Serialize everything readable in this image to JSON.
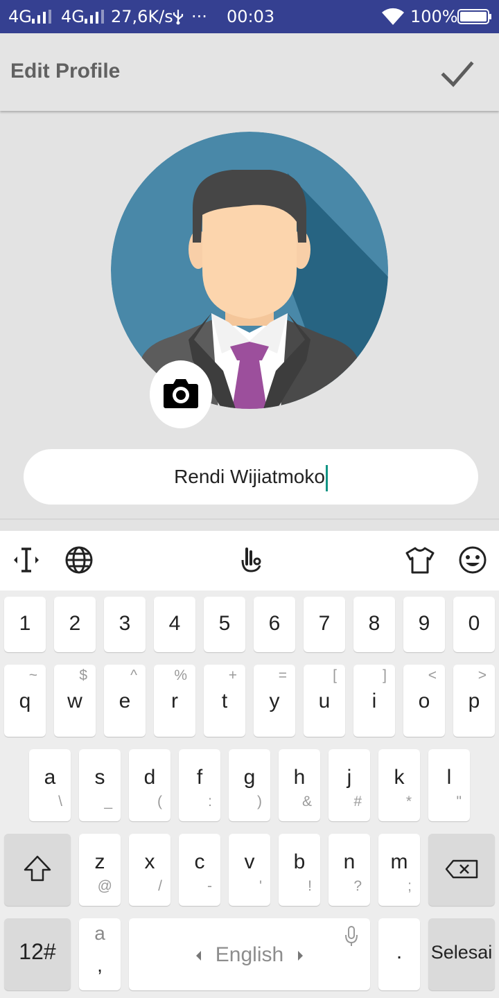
{
  "status_bar": {
    "network1": "4G",
    "network2": "4G",
    "speed": "27,6K/s",
    "usb_icon": "usb-icon",
    "more": "···",
    "time": "00:03",
    "battery": "100%"
  },
  "app_bar": {
    "title": "Edit Profile",
    "confirm_icon": "check-icon"
  },
  "profile": {
    "avatar_icon": "businessman-avatar",
    "camera_icon": "camera-icon",
    "name": "Rendi Wijiatmoko"
  },
  "keyboard": {
    "toolbar_icons": [
      "cursor-icon",
      "globe-icon",
      "gesture-icon",
      "shirt-icon",
      "emoji-icon"
    ],
    "numbers": [
      "1",
      "2",
      "3",
      "4",
      "5",
      "6",
      "7",
      "8",
      "9",
      "0"
    ],
    "row1": [
      {
        "main": "q",
        "sub": "~"
      },
      {
        "main": "w",
        "sub": "$"
      },
      {
        "main": "e",
        "sub": "^"
      },
      {
        "main": "r",
        "sub": "%"
      },
      {
        "main": "t",
        "sub": "+"
      },
      {
        "main": "y",
        "sub": "="
      },
      {
        "main": "u",
        "sub": "["
      },
      {
        "main": "i",
        "sub": "]"
      },
      {
        "main": "o",
        "sub": "<"
      },
      {
        "main": "p",
        "sub": ">"
      }
    ],
    "row2": [
      {
        "main": "a",
        "sub": "\\"
      },
      {
        "main": "s",
        "sub": "_"
      },
      {
        "main": "d",
        "sub": "("
      },
      {
        "main": "f",
        "sub": ":"
      },
      {
        "main": "g",
        "sub": ")"
      },
      {
        "main": "h",
        "sub": "&"
      },
      {
        "main": "j",
        "sub": "#"
      },
      {
        "main": "k",
        "sub": "*"
      },
      {
        "main": "l",
        "sub": "\""
      }
    ],
    "row3": [
      {
        "main": "z",
        "sub": "@"
      },
      {
        "main": "x",
        "sub": "/"
      },
      {
        "main": "c",
        "sub": "-"
      },
      {
        "main": "v",
        "sub": "'"
      },
      {
        "main": "b",
        "sub": "!"
      },
      {
        "main": "n",
        "sub": "?"
      },
      {
        "main": "m",
        "sub": ";"
      }
    ],
    "symbols_key": "12#",
    "alt_key_main": "a",
    "alt_key_sub": ",",
    "space_label": "English",
    "period": ".",
    "done": "Selesai",
    "accent": "#129484"
  }
}
